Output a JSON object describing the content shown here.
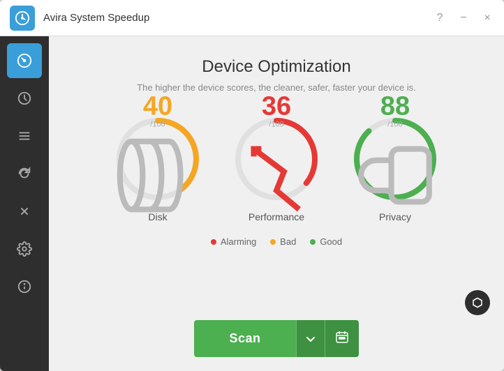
{
  "window": {
    "title": "Avira System Speedup",
    "controls": {
      "help": "?",
      "minimize": "−",
      "close": "×"
    }
  },
  "sidebar": {
    "items": [
      {
        "id": "speedometer",
        "icon": "⏱",
        "active": true
      },
      {
        "id": "clock",
        "icon": "⏰",
        "active": false
      },
      {
        "id": "list",
        "icon": "☰",
        "active": false
      },
      {
        "id": "refresh",
        "icon": "↻",
        "active": false
      },
      {
        "id": "tools",
        "icon": "✂",
        "active": false
      },
      {
        "id": "settings",
        "icon": "⚙",
        "active": false
      },
      {
        "id": "info",
        "icon": "ℹ",
        "active": false
      }
    ]
  },
  "content": {
    "title": "Device Optimization",
    "subtitle": "The higher the device scores, the cleaner, safer, faster your device is.",
    "scores": [
      {
        "id": "disk",
        "label": "Disk",
        "value": 40,
        "max": 100,
        "color": "#f5a623",
        "percent": 40,
        "icon": "disk"
      },
      {
        "id": "performance",
        "label": "Performance",
        "value": 36,
        "max": 100,
        "color": "#e53935",
        "percent": 36,
        "icon": "chart"
      },
      {
        "id": "privacy",
        "label": "Privacy",
        "value": 88,
        "max": 100,
        "color": "#4caf50",
        "percent": 88,
        "icon": "lock"
      }
    ],
    "legend": [
      {
        "label": "Alarming",
        "color": "#e53935"
      },
      {
        "label": "Bad",
        "color": "#f5a623"
      },
      {
        "label": "Good",
        "color": "#4caf50"
      }
    ],
    "scan_button": "Scan"
  }
}
